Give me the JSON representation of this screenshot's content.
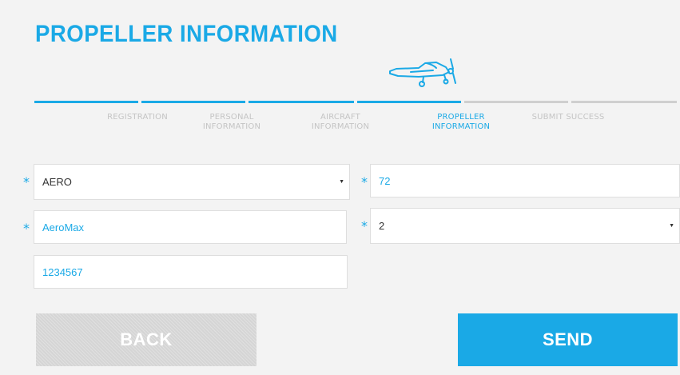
{
  "page": {
    "title": "PROPELLER INFORMATION"
  },
  "steps": [
    {
      "label": "REGISTRATION",
      "state": "done"
    },
    {
      "label": "PERSONAL INFORMATION",
      "state": "done"
    },
    {
      "label": "AIRCRAFT INFORMATION",
      "state": "done"
    },
    {
      "label": "PROPELLER INFORMATION",
      "state": "active"
    },
    {
      "label": "SUBMIT SUCCESS",
      "state": "todo"
    }
  ],
  "form": {
    "manufacturer": {
      "value": "AERO",
      "required": true,
      "type": "select"
    },
    "diameter": {
      "value": "72",
      "required": true,
      "type": "text"
    },
    "model": {
      "value": "AeroMax",
      "required": true,
      "type": "text"
    },
    "blades": {
      "value": "2",
      "required": true,
      "type": "select"
    },
    "serial": {
      "value": "1234567",
      "required": false,
      "type": "text"
    },
    "required_marker": "*"
  },
  "buttons": {
    "back_label": "BACK",
    "send_label": "SEND"
  },
  "icons": {
    "progress": "airplane-icon",
    "dropdown": "caret-down-icon"
  },
  "colors": {
    "accent": "#1aa9e6",
    "inactive": "#cfcfcf",
    "back_button": "#d5d5d5"
  }
}
